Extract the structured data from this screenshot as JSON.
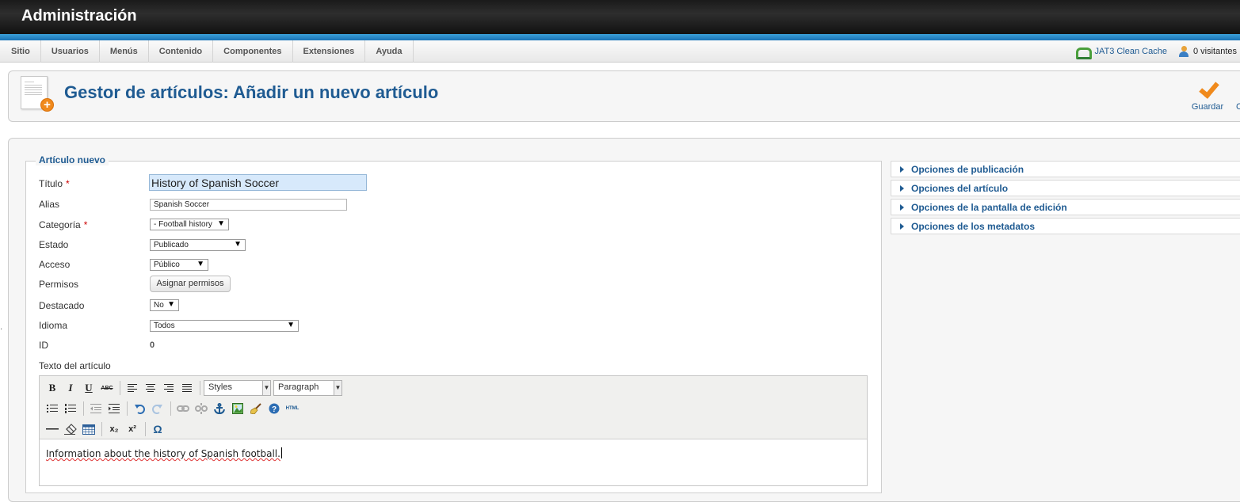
{
  "app": {
    "title": "Administración"
  },
  "menu": {
    "items": [
      "Sitio",
      "Usuarios",
      "Menús",
      "Contenido",
      "Componentes",
      "Extensiones",
      "Ayuda"
    ],
    "cache_label": "JAT3 Clean Cache",
    "visitors_label": "0 visitantes"
  },
  "header": {
    "title": "Gestor de artículos: Añadir un nuevo artículo",
    "save_label": "Guardar",
    "cut_label": "C"
  },
  "form": {
    "legend": "Artículo nuevo",
    "title_label": "Título",
    "title_value": "History of Spanish Soccer",
    "alias_label": "Alias",
    "alias_value": "Spanish Soccer",
    "category_label": "Categoría",
    "category_value": "- Football history",
    "state_label": "Estado",
    "state_value": "Publicado",
    "access_label": "Acceso",
    "access_value": "Público",
    "permissions_label": "Permisos",
    "permissions_button": "Asignar permisos",
    "featured_label": "Destacado",
    "featured_value": "No",
    "language_label": "Idioma",
    "language_value": "Todos",
    "id_label": "ID",
    "id_value": "0",
    "text_label": "Texto del artículo",
    "required_mark": "*"
  },
  "editor": {
    "bold": "B",
    "italic": "I",
    "underline": "U",
    "strike": "ABC",
    "styles": "Styles",
    "paragraph": "Paragraph",
    "html": "HTML",
    "subscript": "x₂",
    "superscript": "x²",
    "omega": "Ω",
    "content": "Information about the history of Spanish football."
  },
  "sidebar": {
    "panels": [
      "Opciones de publicación",
      "Opciones del artículo",
      "Opciones de la pantalla de edición",
      "Opciones de los metadatos"
    ]
  }
}
